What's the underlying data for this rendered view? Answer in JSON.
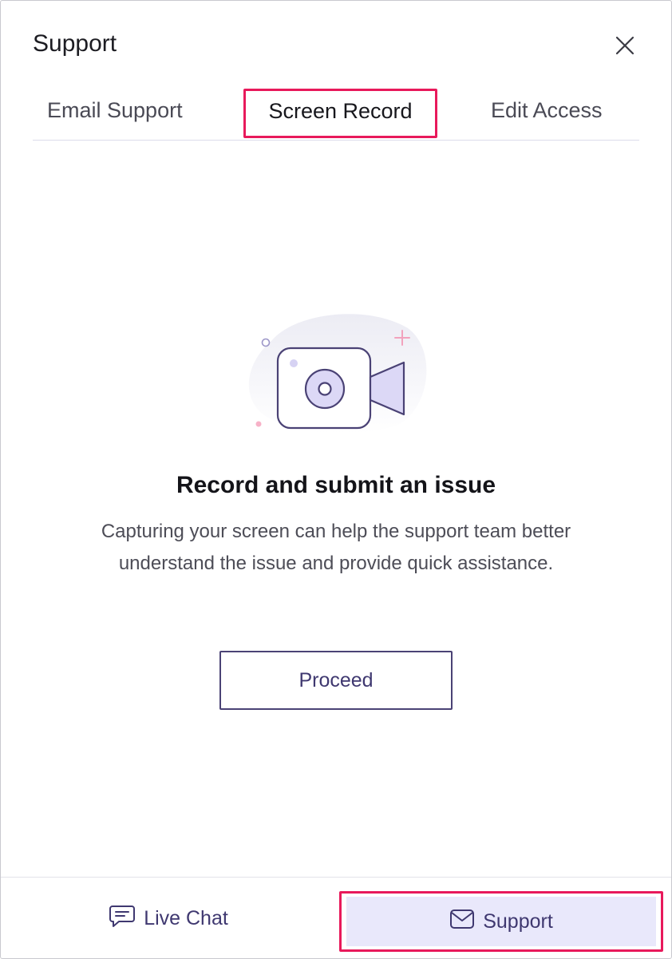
{
  "header": {
    "title": "Support"
  },
  "tabs": [
    {
      "label": "Email Support"
    },
    {
      "label": "Screen Record",
      "selected": true
    },
    {
      "label": "Edit Access"
    }
  ],
  "main": {
    "heading": "Record and submit an issue",
    "description": "Capturing your screen can help the support team better understand the issue and provide quick assistance.",
    "proceed_label": "Proceed",
    "illustration_icon": "video-camera-icon"
  },
  "footer": {
    "live_chat_label": "Live Chat",
    "support_label": "Support"
  },
  "colors": {
    "accent": "#3f3870",
    "highlight": "#e8195b",
    "active_bg": "#e9e8fb"
  }
}
